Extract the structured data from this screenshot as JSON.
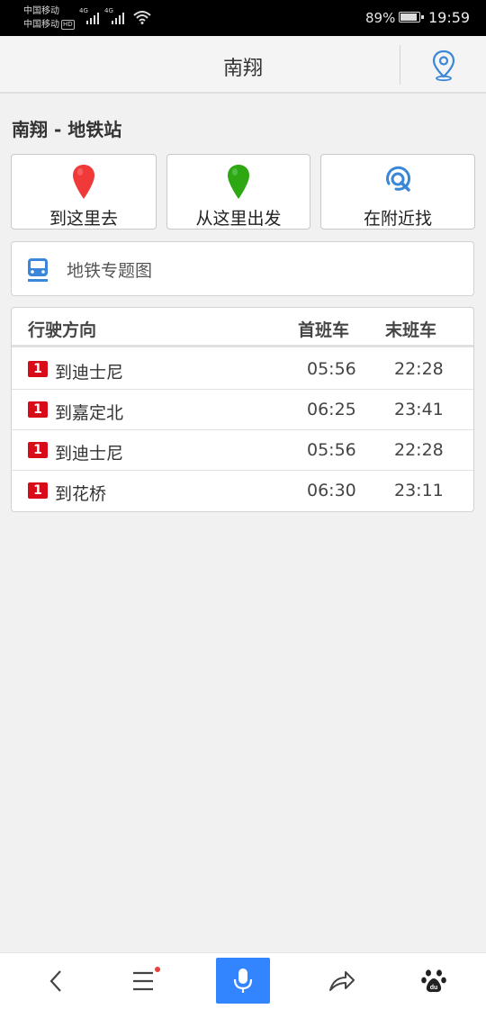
{
  "status_bar": {
    "carrier_1": "中国移动",
    "carrier_2": "中国移动",
    "hd_badge": "HD",
    "network_1": "4G",
    "network_2": "4G",
    "battery_percent": "89%",
    "time": "19:59"
  },
  "header": {
    "title": "南翔",
    "location_icon": "location-pin-icon"
  },
  "station": {
    "title": "南翔 - 地铁站"
  },
  "actions": [
    {
      "label": "到这里去",
      "icon": "red-map-pin-icon",
      "color": "#f03a3a"
    },
    {
      "label": "从这里出发",
      "icon": "green-map-pin-icon",
      "color": "#2ea812"
    },
    {
      "label": "在附近找",
      "icon": "nearby-search-icon",
      "color": "#3a86d8"
    }
  ],
  "metro_map": {
    "label": "地铁专题图",
    "icon": "subway-train-icon"
  },
  "timetable": {
    "headers": {
      "direction": "行驶方向",
      "first": "首班车",
      "last": "末班车"
    },
    "line_color": "#d80c18",
    "rows": [
      {
        "line": "1",
        "direction": "到迪士尼",
        "first": "05:56",
        "last": "22:28"
      },
      {
        "line": "1",
        "direction": "到嘉定北",
        "first": "06:25",
        "last": "23:41"
      },
      {
        "line": "1",
        "direction": "到迪士尼",
        "first": "05:56",
        "last": "22:28"
      },
      {
        "line": "1",
        "direction": "到花桥",
        "first": "06:30",
        "last": "23:11"
      }
    ]
  },
  "bottom_nav": {
    "items": [
      "back-arrow-icon",
      "menu-icon",
      "microphone-icon",
      "share-icon",
      "baidu-paw-icon"
    ],
    "accent": "#3385ff",
    "baidu_label": "du"
  }
}
